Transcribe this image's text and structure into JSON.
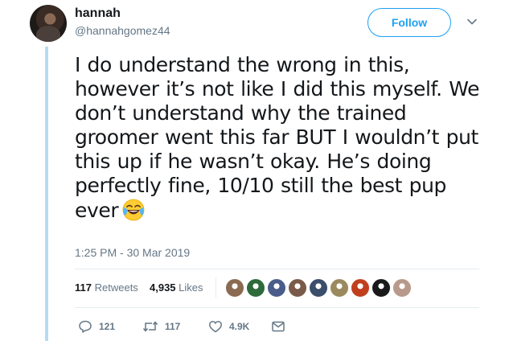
{
  "user": {
    "display_name": "hannah",
    "handle": "@hannahgomez44"
  },
  "follow_button": {
    "label": "Follow"
  },
  "tweet": {
    "text": "I do understand the wrong in this, however it’s not like I did this myself. We don’t understand why the trained groomer went this far BUT I wouldn’t put this up if he wasn’t okay. He’s doing perfectly fine, 10/10 still the best pup ever",
    "emoji": "face-with-tears-of-joy-icon",
    "timestamp": "1:25 PM - 30 Mar 2019"
  },
  "stats": {
    "retweets_count": "117",
    "retweets_label": "Retweets",
    "likes_count": "4,935",
    "likes_label": "Likes"
  },
  "likers": [
    {
      "color": "#8b6a52"
    },
    {
      "color": "#2e6b3a"
    },
    {
      "color": "#4a5d8a"
    },
    {
      "color": "#7a5a48"
    },
    {
      "color": "#3b4e6b"
    },
    {
      "color": "#9a8a5e"
    },
    {
      "color": "#c0401e"
    },
    {
      "color": "#1a1a1a"
    },
    {
      "color": "#b89a8a"
    }
  ],
  "actions": {
    "reply_count": "121",
    "retweet_count": "117",
    "like_count": "4.9K"
  },
  "colors": {
    "accent": "#1da1f2",
    "thread_line": "#b4dcf2",
    "secondary_text": "#657786"
  }
}
